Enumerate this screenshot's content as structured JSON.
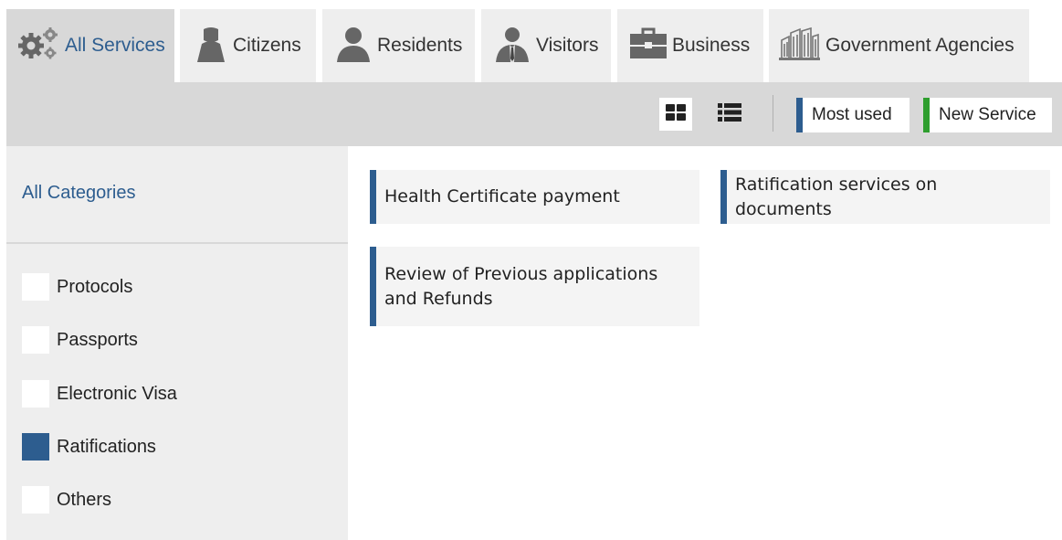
{
  "tabs": [
    {
      "label": "All Services",
      "icon": "gears-icon",
      "active": true
    },
    {
      "label": "Citizens",
      "icon": "citizen-person-icon",
      "active": false
    },
    {
      "label": "Residents",
      "icon": "resident-person-icon",
      "active": false
    },
    {
      "label": "Visitors",
      "icon": "visitor-person-icon",
      "active": false
    },
    {
      "label": "Business",
      "icon": "briefcase-icon",
      "active": false
    },
    {
      "label": "Government Agencies",
      "icon": "government-building-icon",
      "active": false
    }
  ],
  "toolbar": {
    "view_grid_icon": "grid-view-icon",
    "view_list_icon": "list-view-icon",
    "most_used": "Most used",
    "new_service": "New Service"
  },
  "sidebar": {
    "all_categories": "All Categories",
    "categories": [
      {
        "label": "Protocols",
        "checked": false
      },
      {
        "label": "Passports",
        "checked": false
      },
      {
        "label": "Electronic Visa",
        "checked": false
      },
      {
        "label": "Ratifications",
        "checked": true
      },
      {
        "label": "Others",
        "checked": false
      }
    ]
  },
  "services": [
    {
      "title": "Health Certificate payment"
    },
    {
      "title": "Ratification services on documents"
    },
    {
      "title": "Review of Previous applications and Refunds"
    }
  ],
  "colors": {
    "accent": "#2d5d8f",
    "new_service": "#2e9e2e",
    "tab_active_bg": "#d8d8d8",
    "tab_bg": "#eeeeee"
  }
}
